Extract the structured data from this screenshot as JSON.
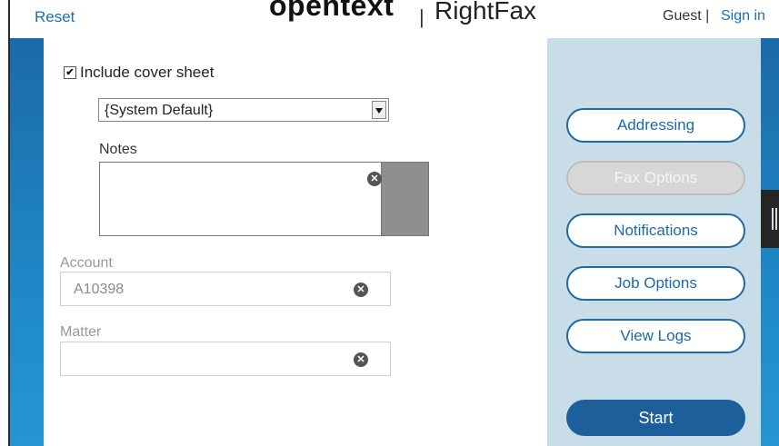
{
  "header": {
    "reset_label": "Reset",
    "brand": "opentext",
    "separator": "|",
    "product": "RightFax",
    "user": "Guest",
    "user_separator": "|",
    "signin_label": "Sign in"
  },
  "cover": {
    "checked": true,
    "check_glyph": "✔",
    "label": "Include cover sheet",
    "template_selected": "{System Default}"
  },
  "notes": {
    "label": "Notes",
    "value": ""
  },
  "account": {
    "label": "Account",
    "value": "A10398"
  },
  "matter": {
    "label": "Matter",
    "value": ""
  },
  "clear_glyph": "✕",
  "side_buttons": [
    {
      "label": "Addressing",
      "enabled": true
    },
    {
      "label": "Fax Options",
      "enabled": false
    },
    {
      "label": "Notifications",
      "enabled": true
    },
    {
      "label": "Job Options",
      "enabled": true
    },
    {
      "label": "View Logs",
      "enabled": true
    }
  ],
  "start_label": "Start",
  "colors": {
    "accent": "#1e6aa7",
    "panel": "#c9dde9",
    "start": "#1c5f9a"
  }
}
